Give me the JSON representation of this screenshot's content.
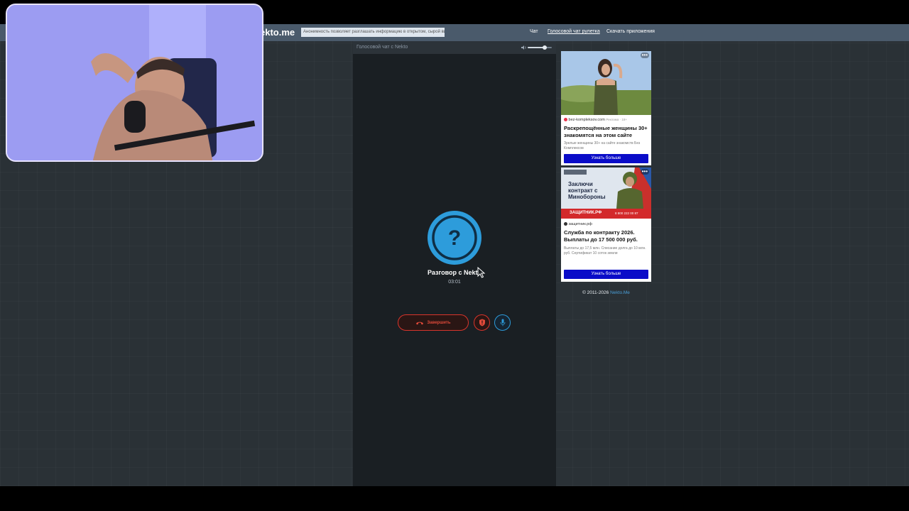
{
  "site": {
    "logo": "ekto.me",
    "notice": "Анонимность позволяет разглашать информацию в открытом, сырой вид!"
  },
  "nav": {
    "chat": "Чат",
    "voice": "Голосовой чат рулетка",
    "apps": "Скачать приложения"
  },
  "panel": {
    "title": "Голосовой чат с Nekto",
    "volume": 0.7,
    "peer_name": "Разговор с Nekto",
    "timer": "03:01",
    "end_label": "Завершить",
    "accent": "#2d9cdb",
    "danger": "#d9342b"
  },
  "ads": [
    {
      "domain": "bez-kompleksov.com",
      "domain_extra": "Реклама · 18+",
      "title": "Раскрепощённые женщины 30+ знакомятся на этом сайте",
      "desc": "Зрелые женщины 30+ на сайте знакомств Без Комплексов",
      "button": "Узнать больше"
    },
    {
      "banner_label": "Заключи контракт с Минобороны",
      "banner_brand": "ЗАЩИТНИК.РФ",
      "banner_phone": "8 800 222 00 87",
      "domain": "защитник.рф",
      "title": "Служба по контракту 2026. Выплаты до 17 500 000 руб.",
      "desc": "Выплаты до 17,5 млн. Списание долга до 10 млн. руб. Сертификат 10 соток земли",
      "button": "Узнать больше"
    }
  ],
  "footer": {
    "copyright": "© 2011-2026 ",
    "link": "Nekto.Me"
  }
}
